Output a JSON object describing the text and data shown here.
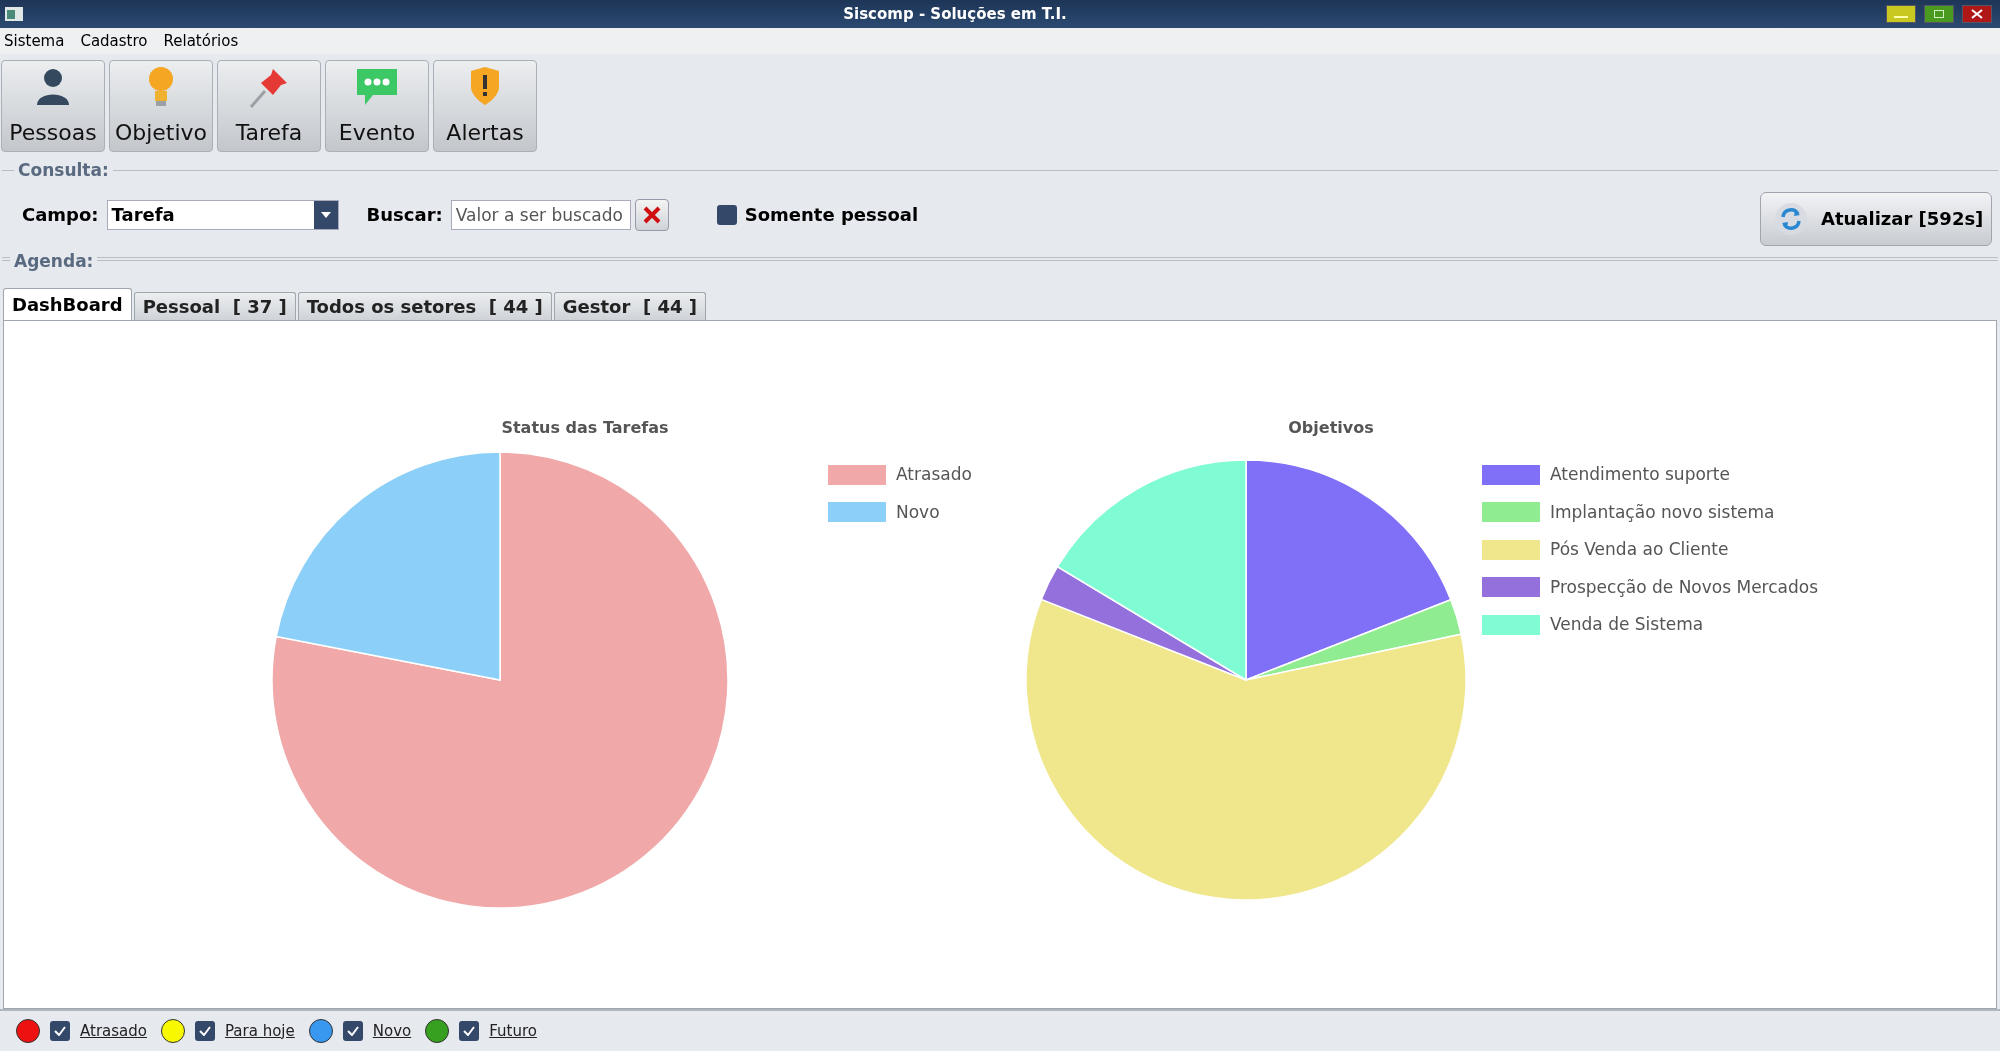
{
  "window": {
    "title": "Siscomp - Soluções em T.I."
  },
  "menu": [
    "Sistema",
    "Cadastro",
    "Relatórios"
  ],
  "toolbar": [
    {
      "label": "Pessoas",
      "kind": "person"
    },
    {
      "label": "Objetivo",
      "kind": "bulb"
    },
    {
      "label": "Tarefa",
      "kind": "pin"
    },
    {
      "label": "Evento",
      "kind": "chat"
    },
    {
      "label": "Alertas",
      "kind": "shield"
    }
  ],
  "consulta": {
    "title": "Consulta:",
    "campo_label": "Campo:",
    "campo_value": "Tarefa",
    "buscar_label": "Buscar:",
    "buscar_placeholder": "Valor a ser buscado",
    "somente_pessoal": {
      "label": "Somente pessoal",
      "checked": false
    },
    "refresh_button": "Atualizar [592s]"
  },
  "agenda": {
    "title": "Agenda:",
    "tabs": [
      {
        "label": "DashBoard",
        "selected": true
      },
      {
        "label": "Pessoal  [ 37 ]",
        "selected": false
      },
      {
        "label": "Todos os setores  [ 44 ]",
        "selected": false
      },
      {
        "label": "Gestor  [ 44 ]",
        "selected": false
      }
    ]
  },
  "charts": [
    {
      "title": "Status das Tarefas",
      "legend": [
        {
          "label": "Atrasado",
          "color": "#f0a8a8"
        },
        {
          "label": "Novo",
          "color": "#8ccff8"
        }
      ]
    },
    {
      "title": "Objetivos",
      "legend": [
        {
          "label": "Atendimento suporte",
          "color": "#8070f8"
        },
        {
          "label": "Implantação novo sistema",
          "color": "#90ec90"
        },
        {
          "label": "Pós Venda ao Cliente",
          "color": "#f0e68c"
        },
        {
          "label": "Prospecção de Novos Mercados",
          "color": "#9370db"
        },
        {
          "label": "Venda de Sistema",
          "color": "#80fcd4"
        }
      ]
    }
  ],
  "status_legend": [
    {
      "label": "Atrasado",
      "color": "#ee1111",
      "checked": true
    },
    {
      "label": "Para hoje",
      "color": "#f8f800",
      "checked": true
    },
    {
      "label": "Novo",
      "color": "#3898f0",
      "checked": true
    },
    {
      "label": "Futuro",
      "color": "#38a020",
      "checked": true
    }
  ]
}
